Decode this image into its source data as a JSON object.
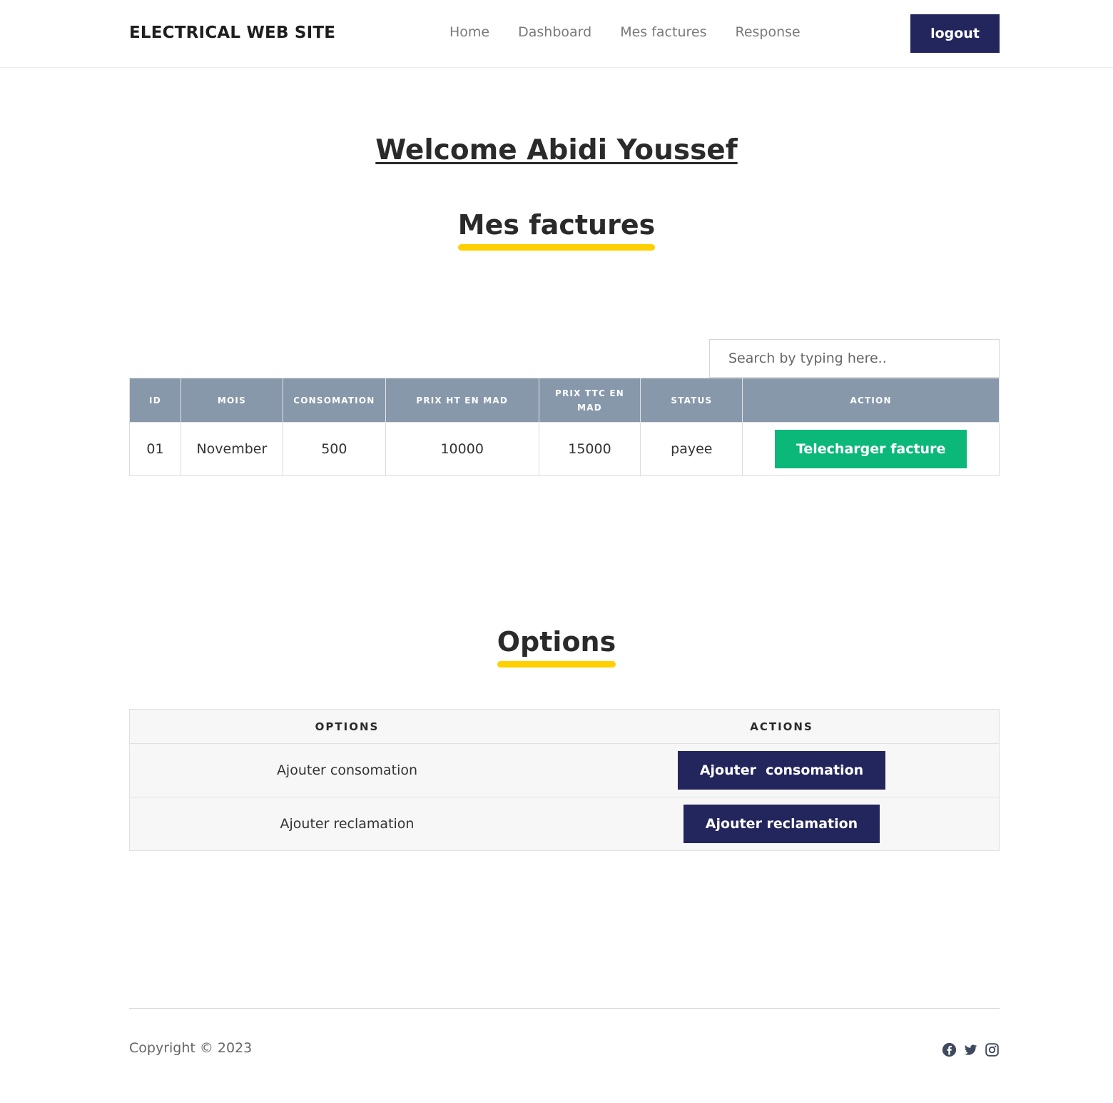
{
  "header": {
    "brand": "ELECTRICAL WEB SITE",
    "nav": [
      "Home",
      "Dashboard",
      "Mes factures",
      "Response"
    ],
    "logout_label": "logout"
  },
  "welcome": "Welcome Abidi Youssef",
  "factures": {
    "title": "Mes factures",
    "search_placeholder": "Search by typing here..",
    "columns": [
      "ID",
      "MOIS",
      "CONSOMATION",
      "PRIX HT EN MAD",
      "PRIX TTC EN MAD",
      "STATUS",
      "ACTION"
    ],
    "rows": [
      {
        "id": "01",
        "mois": "November",
        "consomation": "500",
        "prix_ht": "10000",
        "prix_ttc": "15000",
        "status": "payee",
        "action_label": "Telecharger facture"
      }
    ]
  },
  "options": {
    "title": "Options",
    "columns": [
      "OPTIONS",
      "ACTIONS"
    ],
    "rows": [
      {
        "option": "Ajouter consomation",
        "action_label": "Ajouter  consomation"
      },
      {
        "option": "Ajouter reclamation",
        "action_label": "Ajouter reclamation"
      }
    ]
  },
  "footer": {
    "copyright": "Copyright © 2023",
    "social_icons": [
      "facebook-icon",
      "twitter-icon",
      "instagram-icon"
    ]
  },
  "colors": {
    "navy": "#23265c",
    "green": "#0bb879",
    "accent_yellow": "#ffcf00",
    "table_header": "#8798ab"
  }
}
